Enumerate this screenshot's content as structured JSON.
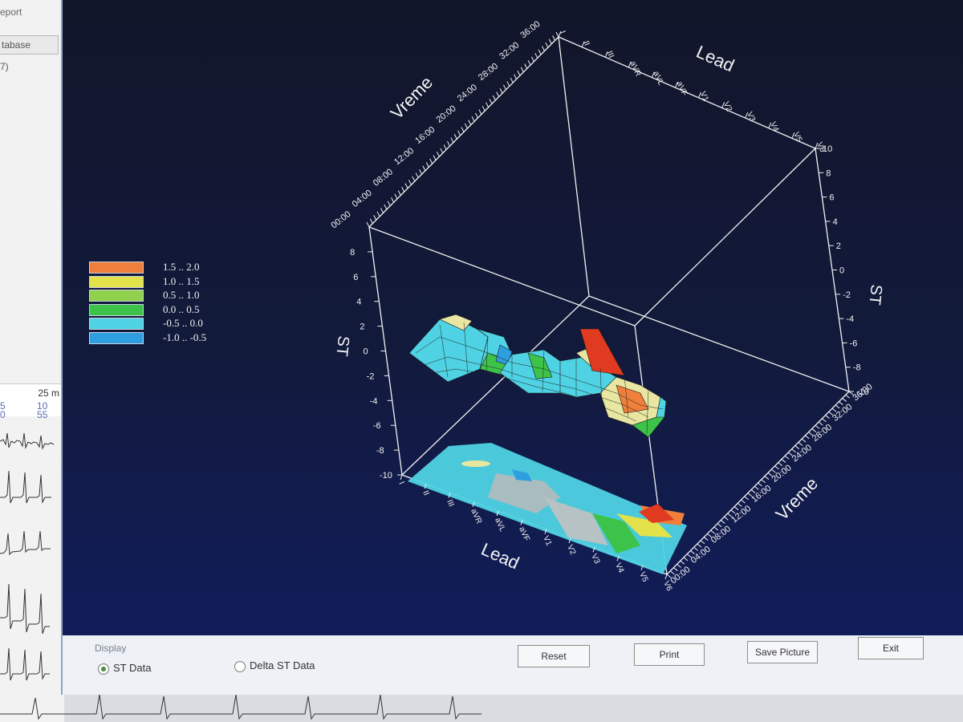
{
  "background_app": {
    "menu_fragment": "eport",
    "tab_fragment": "tabase",
    "paren_fragment": "7)",
    "ecg_scale": "25 m",
    "left_numbers": [
      "5",
      "0"
    ],
    "right_numbers": [
      "10",
      "55"
    ]
  },
  "plot": {
    "z_axis_title": "ST",
    "time_axis_title": "Vreme",
    "lead_axis_title": "Lead",
    "leads": [
      "I",
      "II",
      "III",
      "aVR",
      "aVL",
      "aVF",
      "V1",
      "V2",
      "V3",
      "V4",
      "V5",
      "V6"
    ],
    "time_ticks": [
      "00:00",
      "04:00",
      "08:00",
      "12:00",
      "16:00",
      "20:00",
      "24:00",
      "28:00",
      "32:00",
      "36:00"
    ],
    "st_ticks": [
      "-10",
      "-8",
      "-6",
      "-4",
      "-2",
      "0",
      "2",
      "4",
      "6",
      "8",
      "10"
    ],
    "st_range": [
      -10,
      10
    ]
  },
  "legend": [
    {
      "range": "1.5 .. 2.0",
      "color": "#ef7f3a"
    },
    {
      "range": "1.0 .. 1.5",
      "color": "#e3e24a"
    },
    {
      "range": "0.5 .. 1.0",
      "color": "#8fd14c"
    },
    {
      "range": "0.0 .. 0.5",
      "color": "#3dc34a"
    },
    {
      "range": "-0.5 .. 0.0",
      "color": "#4fd2e3"
    },
    {
      "range": "-1.0 .. -0.5",
      "color": "#2f9ee0"
    }
  ],
  "display_group": {
    "title": "Display",
    "options": [
      {
        "label": "ST Data",
        "selected": true
      },
      {
        "label": "Delta ST Data",
        "selected": false
      }
    ]
  },
  "buttons": {
    "reset": "Reset",
    "print": "Print",
    "save_picture": "Save Picture",
    "exit": "Exit"
  },
  "colors": {
    "plot_background": "#121a3c",
    "axis_lines": "#f2f2f2",
    "peak": "#e03a20"
  }
}
